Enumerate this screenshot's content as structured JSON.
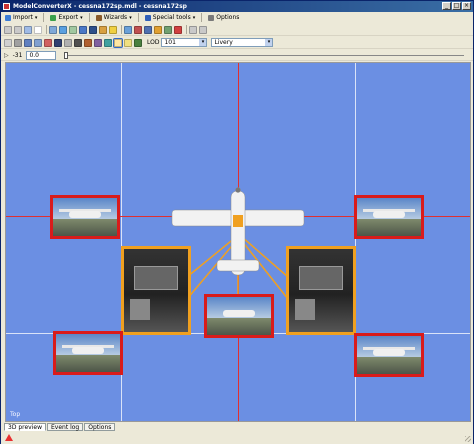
{
  "window": {
    "title": "ModelConverterX - cessna172sp.mdl - cessna172sp",
    "controls": [
      "minimize",
      "maximize",
      "close"
    ]
  },
  "menubar": {
    "items": [
      {
        "label": "Import",
        "icon": "import-icon",
        "has_caret": true
      },
      {
        "label": "Export",
        "icon": "export-icon",
        "has_caret": true
      },
      {
        "label": "Wizards",
        "icon": "wizard-icon",
        "has_caret": true
      },
      {
        "label": "Special tools",
        "icon": "tools-icon",
        "has_caret": true
      },
      {
        "label": "Options",
        "icon": "options-icon",
        "has_caret": false
      }
    ]
  },
  "toolbar2": {
    "lod_label": "LOD",
    "lod_value": "101",
    "livery_label": "Livery",
    "livery_value": ""
  },
  "toolbar3": {
    "frame_label": "-31",
    "frame_value": "0.0",
    "slider_value": 0
  },
  "viewport": {
    "view_label": "Top",
    "background": "#6b8fe3",
    "axis_color": "#e03030"
  },
  "thumbnails": [
    {
      "name": "left-upper-exterior",
      "kind": "exterior",
      "border": "red"
    },
    {
      "name": "right-upper-exterior",
      "kind": "exterior",
      "border": "red"
    },
    {
      "name": "left-cockpit",
      "kind": "cockpit",
      "border": "orange"
    },
    {
      "name": "right-cockpit",
      "kind": "cockpit",
      "border": "orange"
    },
    {
      "name": "center-tail",
      "kind": "exterior",
      "border": "red"
    },
    {
      "name": "left-lower-exterior",
      "kind": "exterior",
      "border": "red"
    },
    {
      "name": "right-lower-exterior",
      "kind": "exterior",
      "border": "red"
    }
  ],
  "statusbar": {
    "tabs": [
      {
        "label": "3D preview",
        "active": true
      },
      {
        "label": "Event log",
        "active": false
      },
      {
        "label": "Options",
        "active": false
      }
    ],
    "warning_icon": "warning-icon"
  },
  "colors": {
    "highlight_red": "#d91b1b",
    "highlight_orange": "#f0a020",
    "titlebar": "#0a246a"
  }
}
